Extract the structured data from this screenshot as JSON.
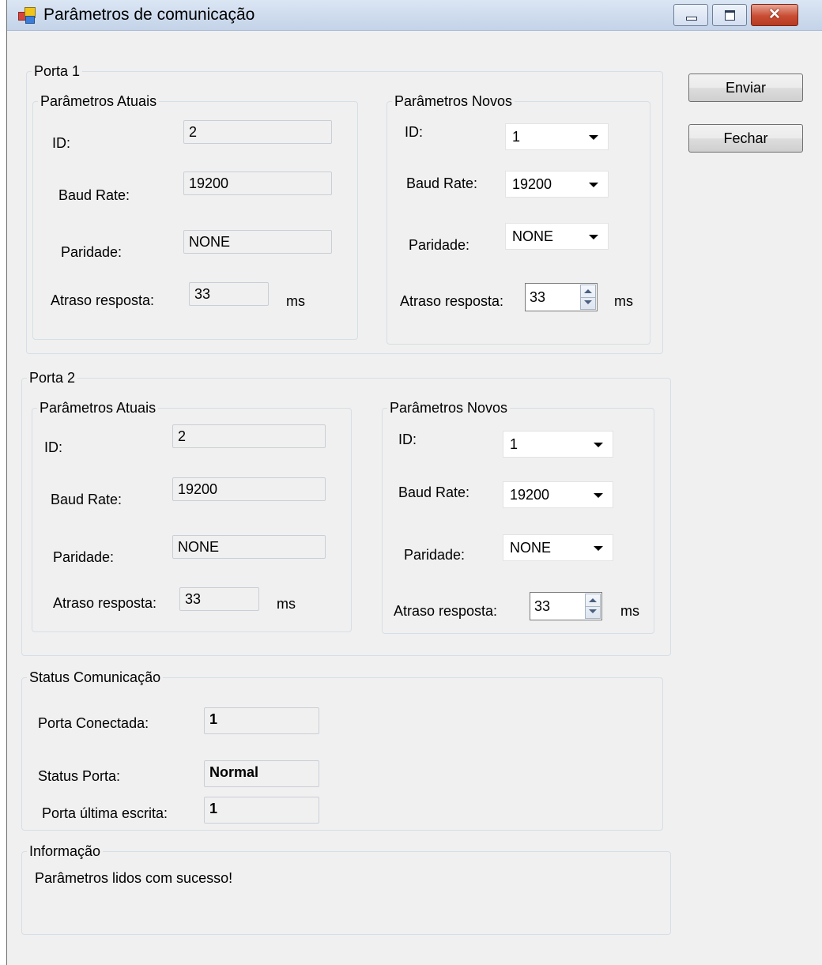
{
  "window": {
    "title": "Parâmetros de comunicação"
  },
  "buttons": {
    "send": "Enviar",
    "close": "Fechar"
  },
  "ports": [
    {
      "title": "Porta 1",
      "current": {
        "title": "Parâmetros Atuais",
        "id_label": "ID:",
        "id": "2",
        "baud_label": "Baud Rate:",
        "baud": "19200",
        "parity_label": "Paridade:",
        "parity": "NONE",
        "delay_label": "Atraso resposta:",
        "delay": "33",
        "unit": "ms"
      },
      "new": {
        "title": "Parâmetros Novos",
        "id_label": "ID:",
        "id": "1",
        "baud_label": "Baud Rate:",
        "baud": "19200",
        "parity_label": "Paridade:",
        "parity": "NONE",
        "delay_label": "Atraso resposta:",
        "delay": "33",
        "unit": "ms"
      }
    },
    {
      "title": "Porta 2",
      "current": {
        "title": "Parâmetros Atuais",
        "id_label": "ID:",
        "id": "2",
        "baud_label": "Baud Rate:",
        "baud": "19200",
        "parity_label": "Paridade:",
        "parity": "NONE",
        "delay_label": "Atraso resposta:",
        "delay": "33",
        "unit": "ms"
      },
      "new": {
        "title": "Parâmetros Novos",
        "id_label": "ID:",
        "id": "1",
        "baud_label": "Baud Rate:",
        "baud": "19200",
        "parity_label": "Paridade:",
        "parity": "NONE",
        "delay_label": "Atraso resposta:",
        "delay": "33",
        "unit": "ms"
      }
    }
  ],
  "status": {
    "title": "Status Comunicação",
    "connected_label": "Porta Conectada:",
    "connected": "1",
    "status_label": "Status Porta:",
    "status": "Normal",
    "last_write_label": "Porta última escrita:",
    "last_write": "1"
  },
  "info": {
    "title": "Informação",
    "message": "Parâmetros lidos com sucesso!"
  }
}
